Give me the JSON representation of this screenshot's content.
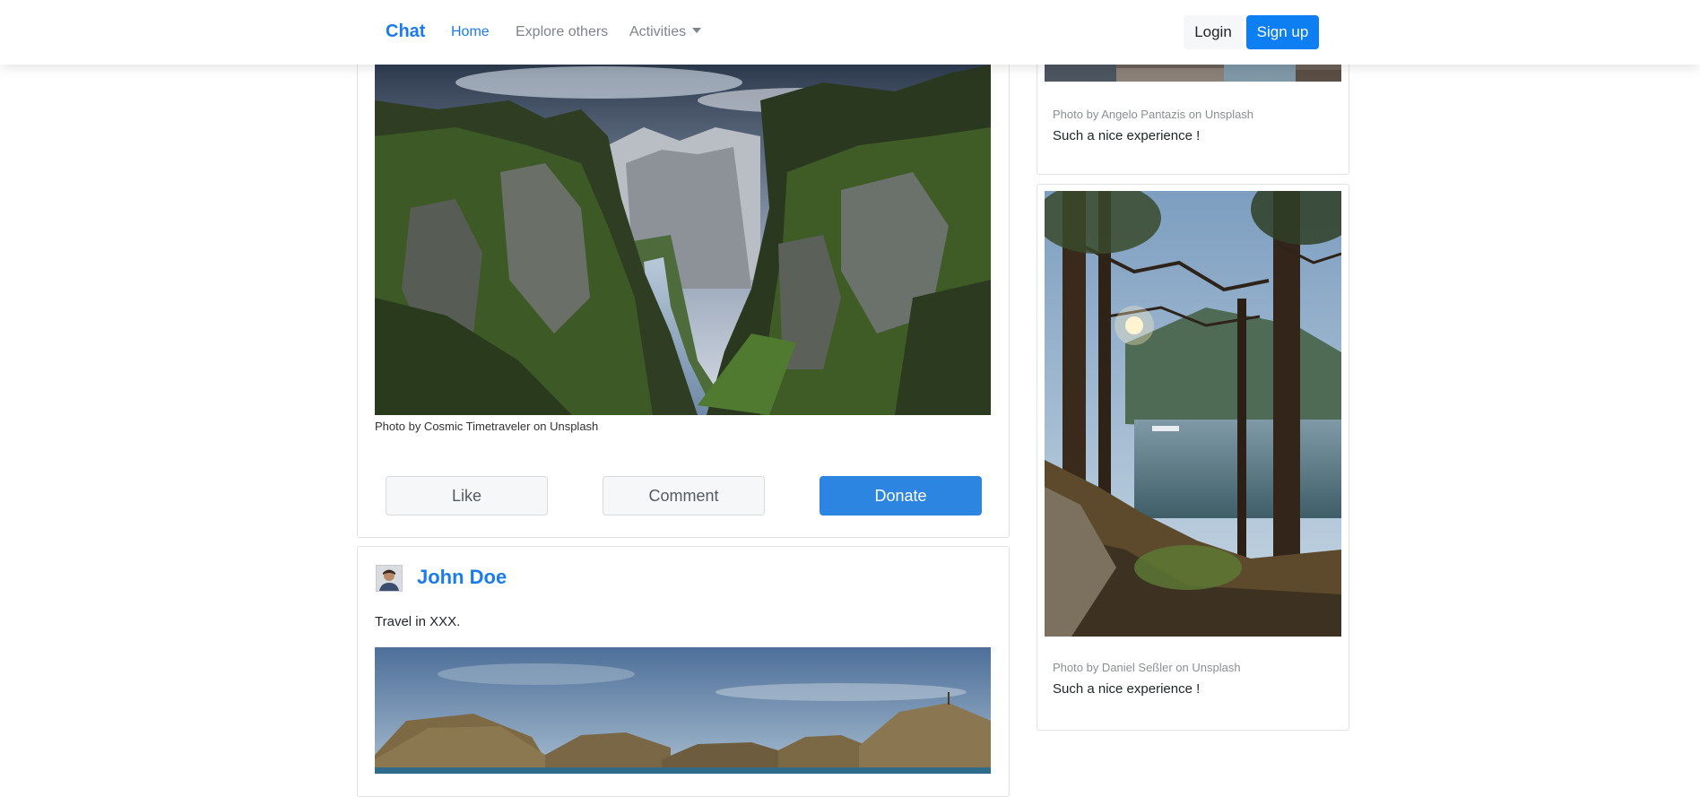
{
  "navbar": {
    "brand": "Chat",
    "links": [
      "Home",
      "Explore others",
      "Activities"
    ],
    "login": "Login",
    "signup": "Sign up"
  },
  "post_top": {
    "photo_credit": "Photo by Cosmic Timetraveler on Unsplash",
    "actions": {
      "like": "Like",
      "comment": "Comment",
      "donate": "Donate"
    }
  },
  "post_second": {
    "author": "John Doe",
    "text": "Travel in XXX."
  },
  "sidebar": {
    "cards": [
      {
        "credit": "Photo by Angelo Pantazis on Unsplash",
        "text": "Such a nice experience !"
      },
      {
        "credit": "Photo by Daniel Seßler on Unsplash",
        "text": "Such a nice experience !"
      }
    ]
  },
  "colors": {
    "accent": "#1a7bea",
    "donate": "#2c85e0",
    "signup": "#0d7ff2"
  },
  "icons": {
    "dropdown": "caret-down-icon"
  }
}
